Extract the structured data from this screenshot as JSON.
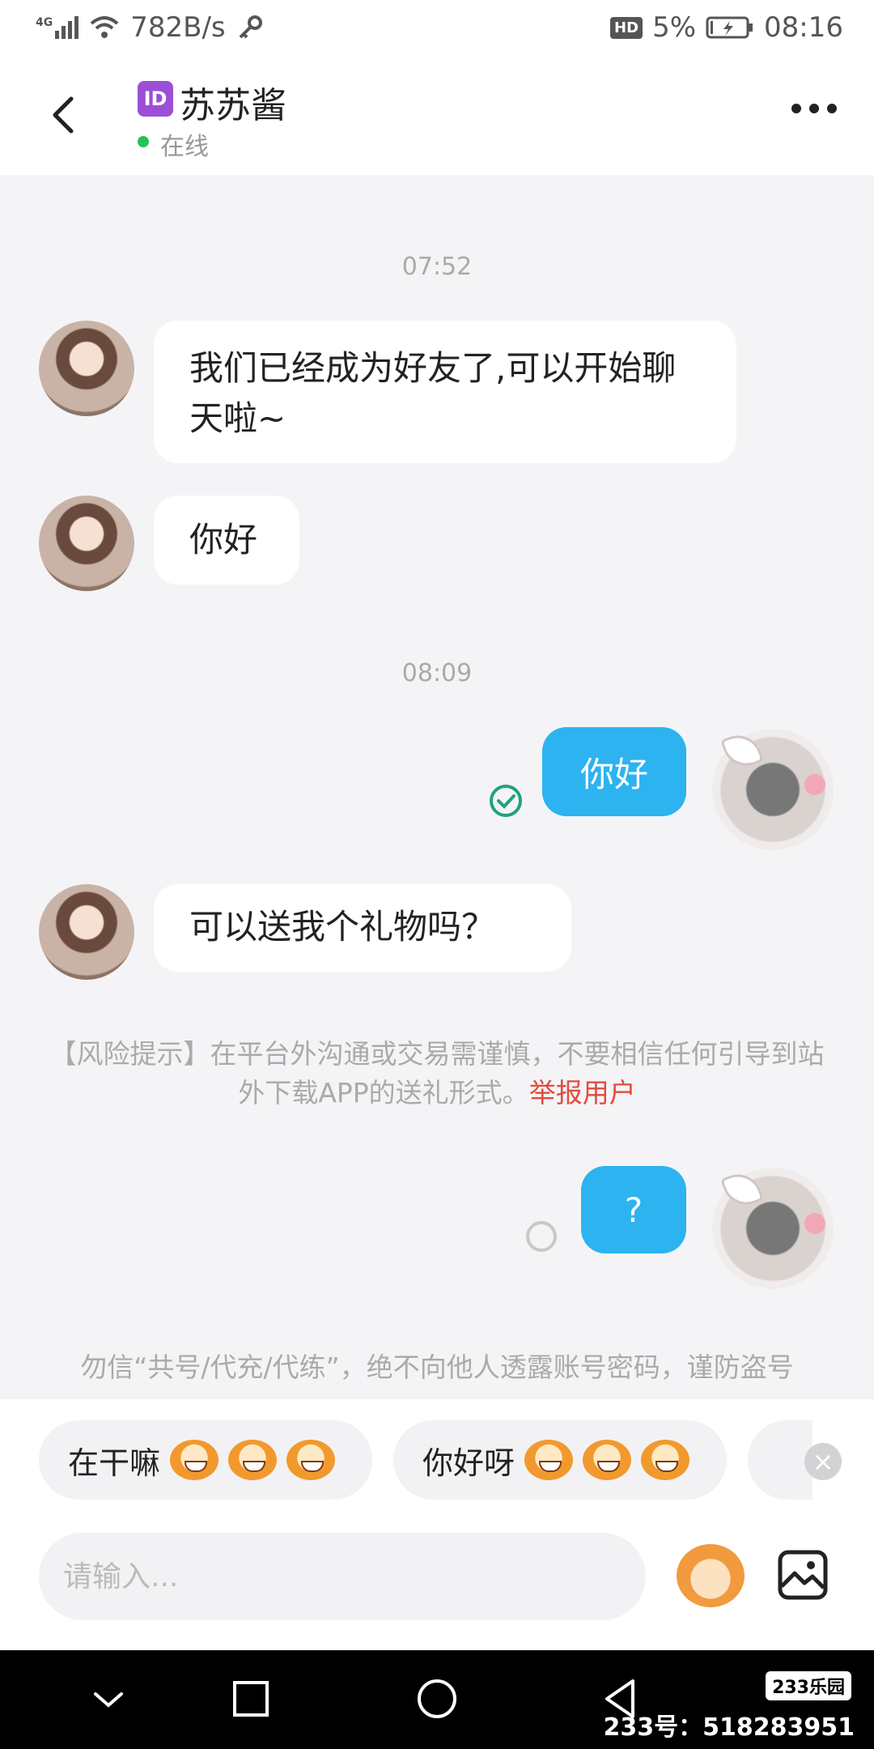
{
  "status_bar": {
    "network": "4G",
    "speed": "782B/s",
    "hd": "HD",
    "battery": "5%",
    "time": "08:16"
  },
  "header": {
    "id_badge": "ID",
    "name": "苏苏酱",
    "status": "在线"
  },
  "messages": {
    "time1": "07:52",
    "m1": "我们已经成为好友了,可以开始聊天啦~",
    "m2": "你好",
    "time2": "08:09",
    "m3": "你好",
    "m4": "可以送我个礼物吗？",
    "risk_text": "【风险提示】在平台外沟通或交易需谨慎，不要相信任何引导到站外下载APP的送礼形式。",
    "risk_link": "举报用户",
    "m5": "?",
    "warning": "勿信“共号/代充/代练”，绝不向他人透露账号密码，谨防盗号"
  },
  "quick_replies": [
    {
      "text": "在干嘛"
    },
    {
      "text": "你好呀"
    }
  ],
  "input": {
    "placeholder": "请输入..."
  },
  "watermark": {
    "logo": "233乐园",
    "text": "233号：518283951"
  },
  "colors": {
    "accent": "#2cb3f0",
    "online": "#22c35e",
    "report": "#e34b3e"
  }
}
